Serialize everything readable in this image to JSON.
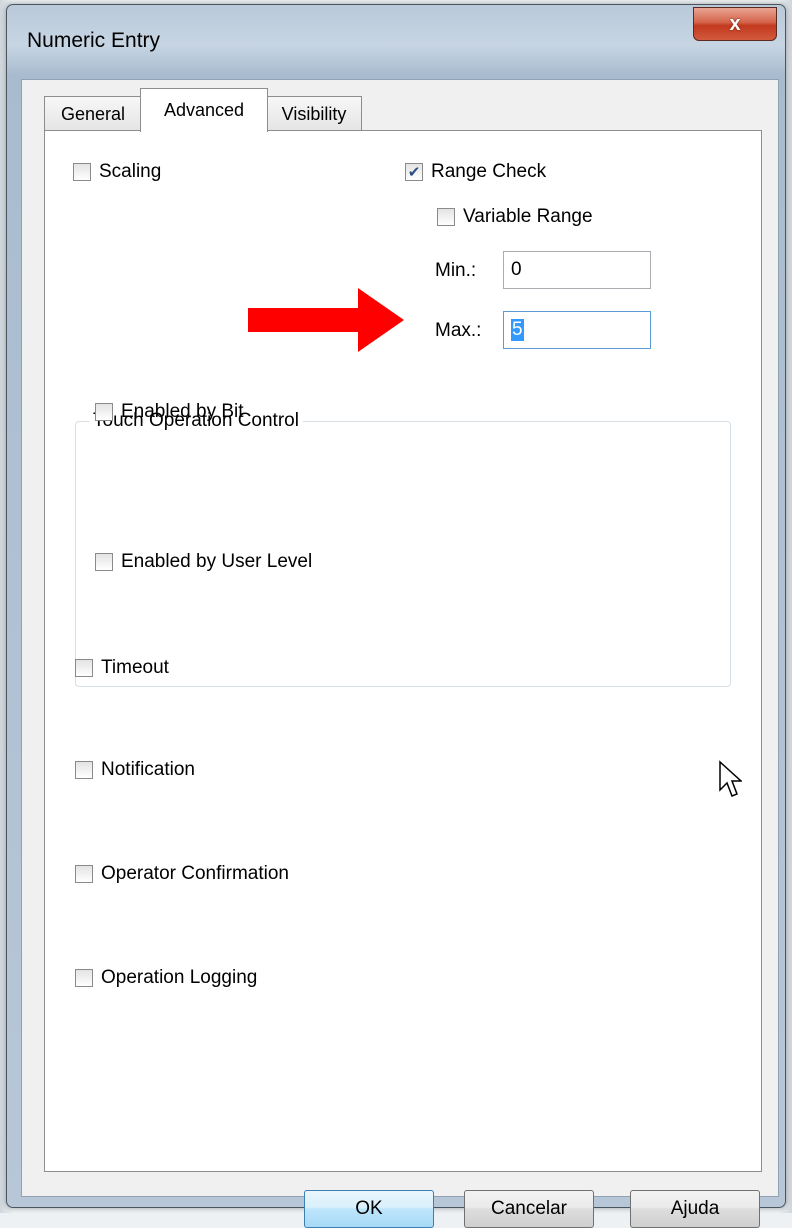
{
  "window": {
    "title": "Numeric Entry",
    "close_label": "x"
  },
  "tabs": [
    {
      "label": "General",
      "active": false
    },
    {
      "label": "Advanced",
      "active": true
    },
    {
      "label": "Visibility",
      "active": false
    }
  ],
  "scaling": {
    "label": "Scaling",
    "checked": false
  },
  "range_check": {
    "label": "Range Check",
    "checked": true,
    "variable_range": {
      "label": "Variable Range",
      "checked": false
    },
    "min": {
      "label": "Min.:",
      "value": "0"
    },
    "max": {
      "label": "Max.:",
      "value": "5"
    }
  },
  "touch_operation_control": {
    "title": "Touch Operation Control",
    "enabled_by_bit": {
      "label": "Enabled by Bit",
      "checked": false
    },
    "enabled_by_user_level": {
      "label": "Enabled by User Level",
      "checked": false
    }
  },
  "timeout": {
    "label": "Timeout",
    "checked": false
  },
  "notification": {
    "label": "Notification",
    "checked": false
  },
  "operator_confirmation": {
    "label": "Operator Confirmation",
    "checked": false
  },
  "operation_logging": {
    "label": "Operation Logging",
    "checked": false
  },
  "buttons": {
    "ok": "OK",
    "cancel": "Cancelar",
    "help": "Ajuda"
  },
  "annotation": {
    "arrow_icon": "red-right-arrow",
    "arrow_color": "#ff0000"
  },
  "colors": {
    "check_mark": "#2b4f86",
    "selection": "#3399ff"
  }
}
